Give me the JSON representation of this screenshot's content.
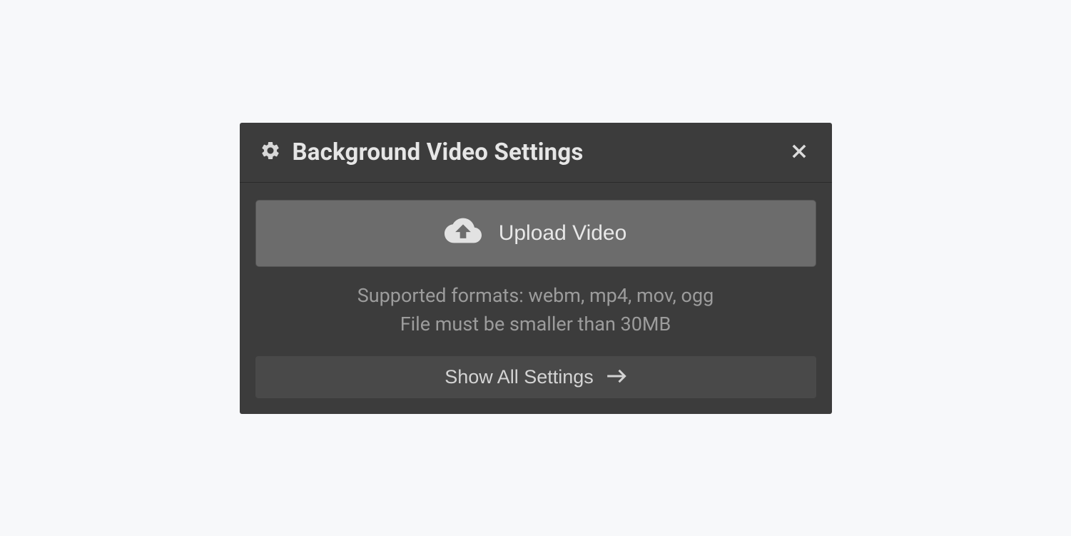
{
  "modal": {
    "title": "Background Video Settings",
    "upload_label": "Upload Video",
    "info_line1": "Supported formats: webm, mp4, mov, ogg",
    "info_line2": "File must be smaller than 30MB",
    "show_all_label": "Show All Settings"
  }
}
